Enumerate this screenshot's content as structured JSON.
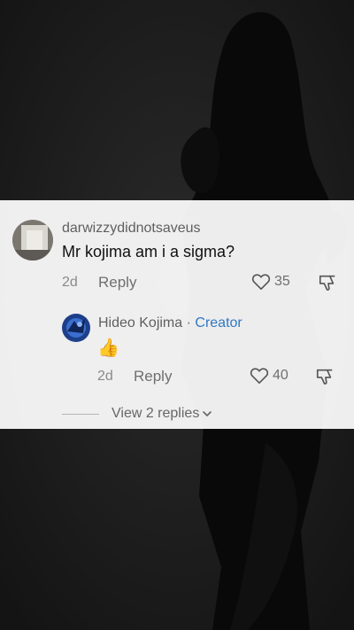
{
  "comment": {
    "username": "darwizzydidnotsaveus",
    "text": "Mr kojima am i a sigma?",
    "age": "2d",
    "reply_label": "Reply",
    "likes": "35",
    "avatar_icon": "user-photo-avatar"
  },
  "reply": {
    "username": "Hideo Kojima",
    "separator": "·",
    "badge": "Creator",
    "text": "👍",
    "age": "2d",
    "reply_label": "Reply",
    "likes": "40",
    "avatar_icon": "creator-avatar"
  },
  "thread": {
    "view_replies_label": "View 2 replies",
    "chevron_icon": "chevron-down-icon"
  },
  "colors": {
    "creator_badge": "#2f78c4",
    "card_bg": "#ffffff",
    "background": "#1b1b1b"
  }
}
